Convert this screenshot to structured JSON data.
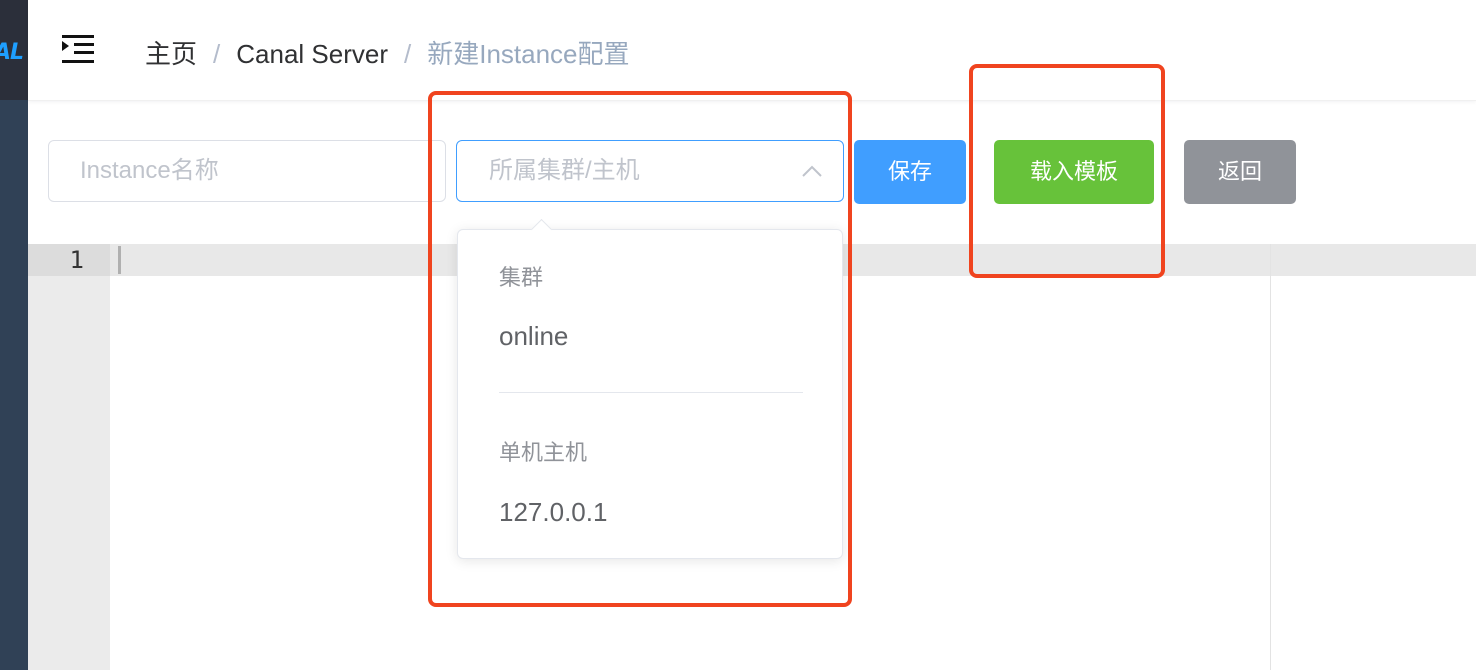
{
  "sidebar": {
    "logo_text": "AL"
  },
  "navbar": {
    "menu_icon": "outdent-icon",
    "breadcrumb": [
      "主页",
      "Canal Server",
      "新建Instance配置"
    ],
    "separator": "/"
  },
  "toolbar": {
    "instance_name_placeholder": "Instance名称",
    "cluster_select_placeholder": "所属集群/主机",
    "save_label": "保存",
    "load_template_label": "载入模板",
    "back_label": "返回"
  },
  "dropdown": {
    "groups": [
      {
        "title": "集群",
        "options": [
          "online"
        ]
      },
      {
        "title": "单机主机",
        "options": [
          "127.0.0.1"
        ]
      }
    ]
  },
  "editor": {
    "line_numbers": [
      "1"
    ]
  },
  "colors": {
    "primary": "#409eff",
    "success": "#67c23a",
    "info": "#909399",
    "highlight": "#f0441f",
    "sidebar": "#304156"
  }
}
